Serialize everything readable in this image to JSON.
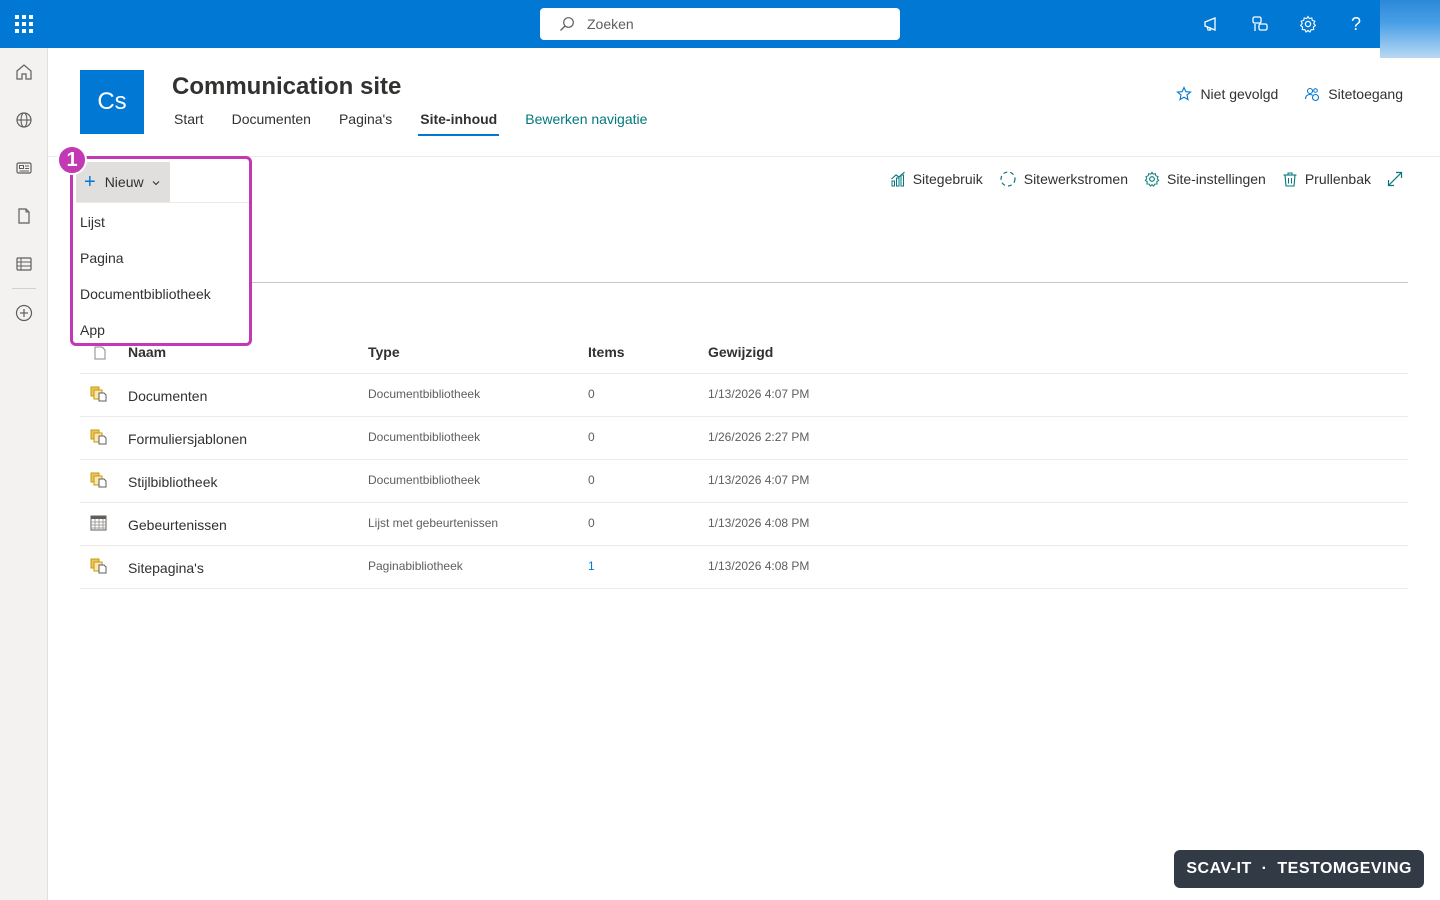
{
  "suitebar": {
    "search_placeholder": "Zoeken",
    "icons": [
      "app-launcher-icon",
      "megaphone-icon",
      "chat-icon",
      "gear-icon",
      "help-icon"
    ]
  },
  "appbar": {
    "items": [
      "home-icon",
      "globe-icon",
      "news-icon",
      "file-icon",
      "lists-icon",
      "add-icon"
    ]
  },
  "site": {
    "logo_text": "Cs",
    "title": "Communication site",
    "nav": [
      "Start",
      "Documenten",
      "Pagina's",
      "Site-inhoud"
    ],
    "nav_active": "Site-inhoud",
    "edit_nav": "Bewerken navigatie",
    "follow": "Niet gevolgd",
    "access": "Sitetoegang"
  },
  "commands": {
    "new": "Nieuw",
    "usage": "Sitegebruik",
    "workflows": "Sitewerkstromen",
    "settings": "Site-instellingen",
    "recycle": "Prullenbak"
  },
  "new_menu": {
    "step": "1",
    "items": [
      "Lijst",
      "Pagina",
      "Documentbibliotheek",
      "App"
    ]
  },
  "table": {
    "columns": [
      "Naam",
      "Type",
      "Items",
      "Gewijzigd"
    ],
    "rows": [
      {
        "name": "Documenten",
        "type": "Documentbibliotheek",
        "items": "0",
        "modified": "1/13/2026 4:07 PM",
        "icon": "library-icon"
      },
      {
        "name": "Formuliersjablonen",
        "type": "Documentbibliotheek",
        "items": "0",
        "modified": "1/26/2026 2:27 PM",
        "icon": "library-icon"
      },
      {
        "name": "Stijlbibliotheek",
        "type": "Documentbibliotheek",
        "items": "0",
        "modified": "1/13/2026 4:07 PM",
        "icon": "library-icon"
      },
      {
        "name": "Gebeurtenissen",
        "type": "Lijst met gebeurtenissen",
        "items": "0",
        "modified": "1/13/2026 4:08 PM",
        "icon": "calendar-icon"
      },
      {
        "name": "Sitepagina's",
        "type": "Paginabibliotheek",
        "items": "1",
        "modified": "1/13/2026 4:08 PM",
        "icon": "library-icon"
      }
    ]
  },
  "env_badge": "SCAV-IT  ·  TESTOMGEVING",
  "colors": {
    "suitebar": "#0078d4",
    "highlight": "#c239b3",
    "accent": "#0078d4",
    "edit_link": "#03787c"
  }
}
